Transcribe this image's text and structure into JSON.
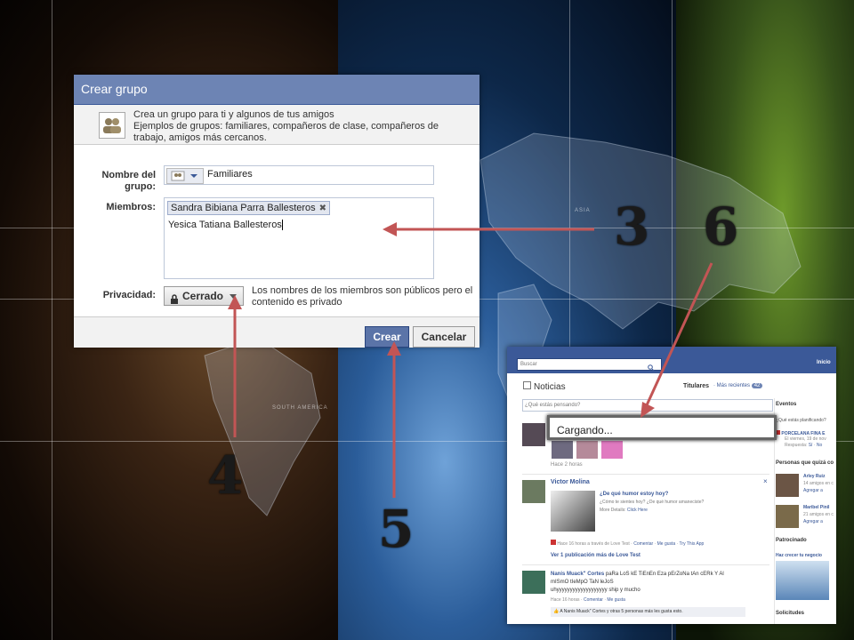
{
  "dialog": {
    "title": "Crear grupo",
    "intro_line1": "Crea un grupo para ti y algunos de tus amigos",
    "intro_line2": "Ejemplos de grupos: familiares, compañeros de clase, compañeros de",
    "intro_line3": "trabajo, amigos más cercanos.",
    "name_label_1": "Nombre del",
    "name_label_2": "grupo:",
    "name_value": "Familiares",
    "members_label": "Miembros:",
    "member_chip": "Sandra Bibiana Parra Ballesteros",
    "member_typing": "Yesica Tatiana Ballesteros",
    "privacy_label": "Privacidad:",
    "privacy_value": "Cerrado",
    "privacy_note_1": "Los nombres de los miembros son públicos pero el",
    "privacy_note_2": "contenido es privado",
    "create_button": "Crear",
    "cancel_button": "Cancelar"
  },
  "annotations": [
    "3",
    "6",
    "4",
    "5"
  ],
  "map_labels": {
    "asia": "ASIA",
    "south_america": "SOUTH AMERICA"
  },
  "feed": {
    "search_placeholder": "Buscar",
    "nav_home": "Inicio",
    "section_title": "Noticias",
    "sort_top": "Titulares",
    "sort_recent": "Más recientes",
    "recent_count": "42",
    "status_prompt": "¿Qué estás pensando?",
    "loading_text": "Cargando...",
    "post1_time": "Hace 2 horas",
    "post2_author": "Victor Molina",
    "post2_app_title": "¿De qué humor estoy hoy?",
    "post2_app_desc": "¿Cómo te sientes hoy? ¿De qué humor amaneciste?",
    "post2_more": "More Details:",
    "post2_click": "Click Here",
    "post2_meta": "Hace 16 horas a través de Love Test",
    "post2_comment": "Comentar",
    "post2_like": "Me gusta",
    "post2_try": "Try This App",
    "post2_more_posts": "Ver 1 publicación más de Love Test",
    "post3_author": "Nanis Muack\" Cortes",
    "post3_text_1": "paRa LoS kE TiEnEn Eza pErZoNa tAn cERk Y Al",
    "post3_text_2": "mISmO tIeMpO TaN leJoS",
    "post3_text_3": "uhyyyyyyyyyyyyyyyyyyy ship y mucho",
    "post3_meta": "Hace 16 horas",
    "post3_comment": "Comentar",
    "post3_like": "Me gusta",
    "post3_likes": "A Nanis Muack\" Cortes y otras 5 personas más les gusta esto.",
    "side_events": "Eventos",
    "side_events_prompt": "¿Qué estás planificando?",
    "side_event_name": "PORCELANA FINA E",
    "side_event_date": "El viernes, 19 de nov",
    "side_event_reply": "Respuesta:",
    "side_event_yes": "Sí",
    "side_event_no": "No",
    "side_people": "Personas que quizá co",
    "side_person1": "Arley Ruiz",
    "side_person1_info": "14 amigos en c",
    "side_person1_add": "Agregar a",
    "side_person2": "Maribel Pinil",
    "side_person2_info": "21 amigos en c",
    "side_person2_add": "Agregar a",
    "side_sponsored": "Patrocinado",
    "side_ad": "Haz crecer tu negocio",
    "side_requests": "Solicitudes"
  }
}
